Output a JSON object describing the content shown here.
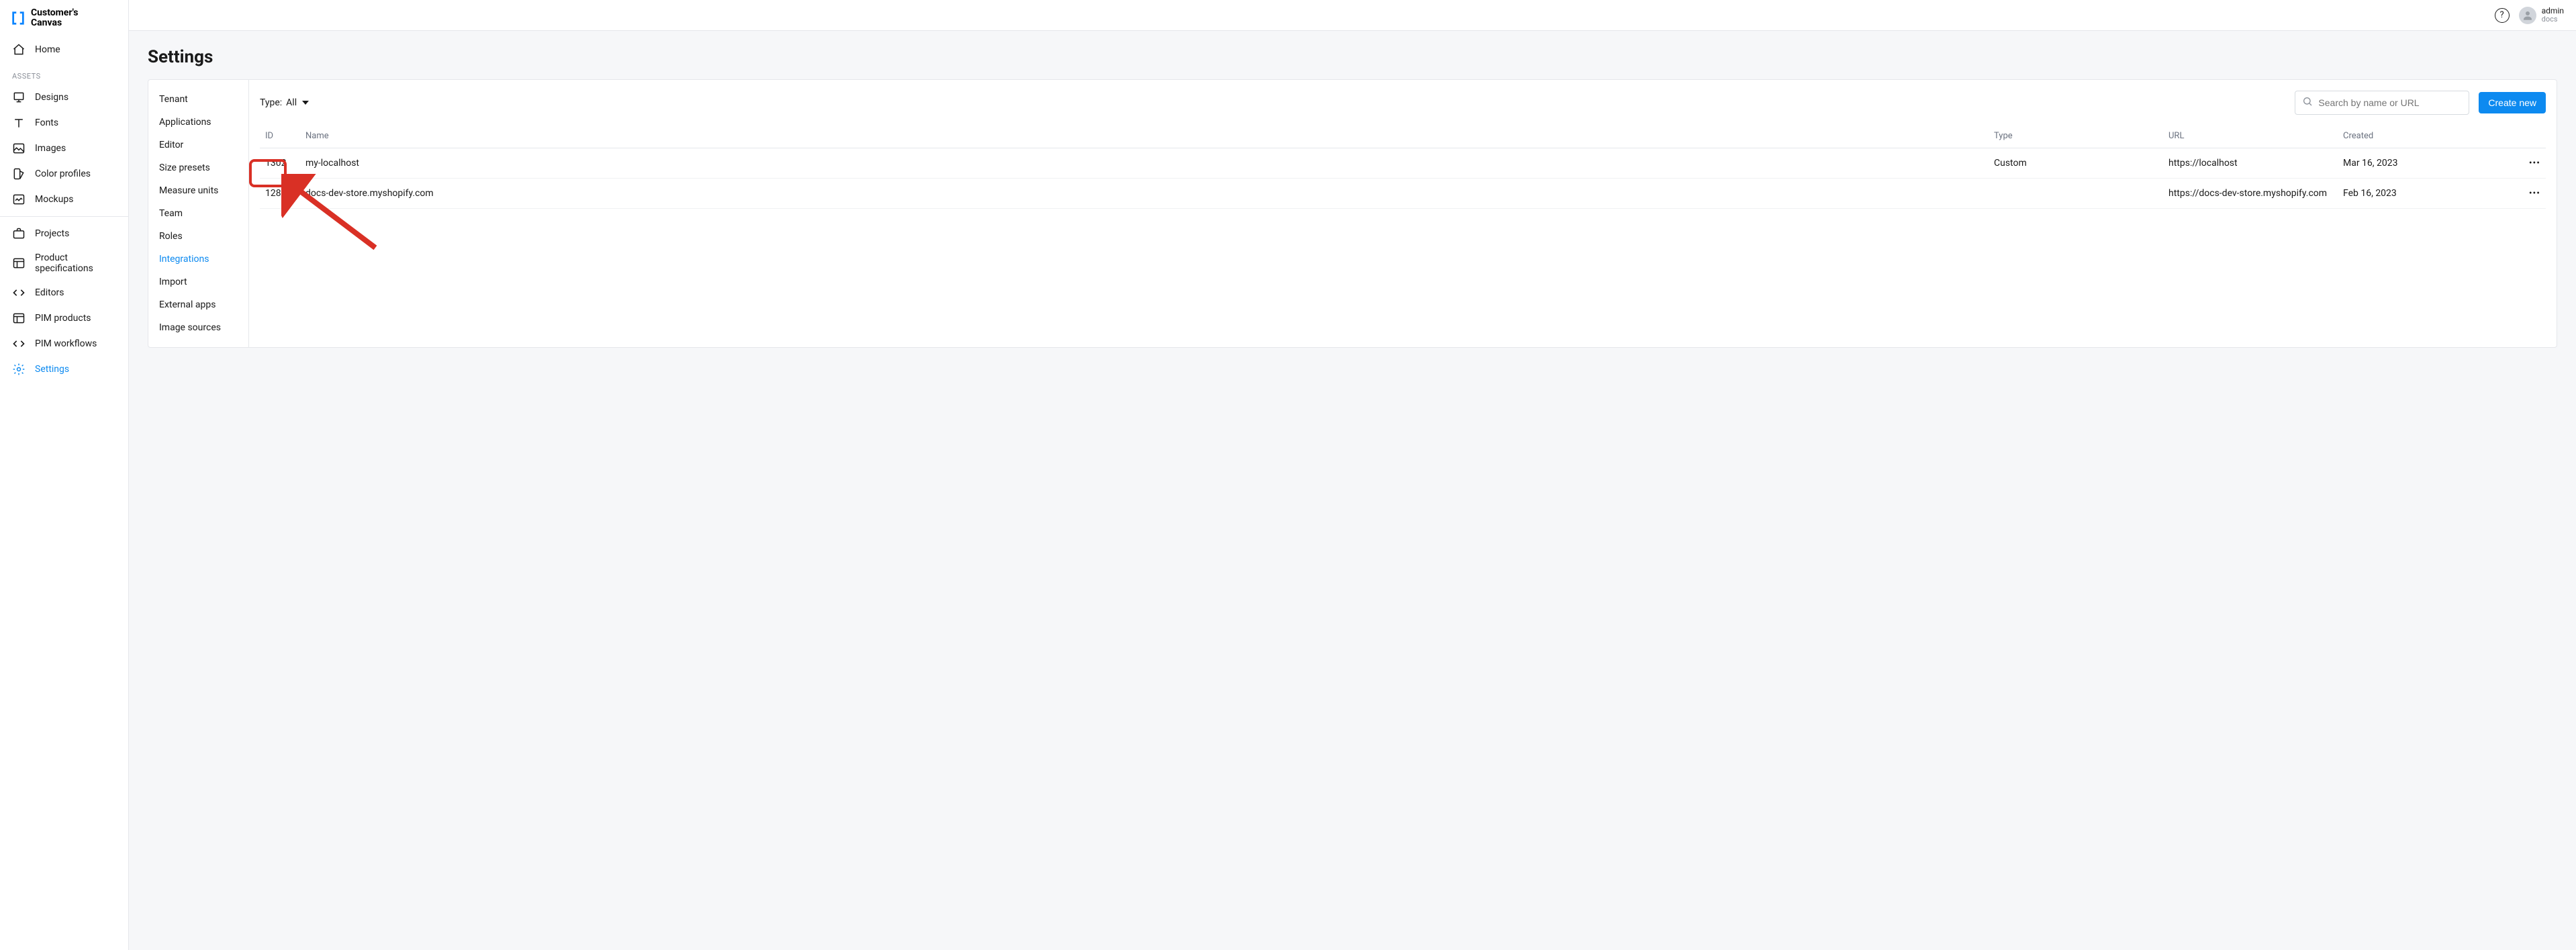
{
  "brand": {
    "name": "Customer's\nCanvas"
  },
  "sidebar": {
    "home": "Home",
    "assets_label": "ASSETS",
    "items_assets": [
      {
        "label": "Designs"
      },
      {
        "label": "Fonts"
      },
      {
        "label": "Images"
      },
      {
        "label": "Color profiles"
      },
      {
        "label": "Mockups"
      }
    ],
    "items_main": [
      {
        "label": "Projects"
      },
      {
        "label": "Product specifications"
      },
      {
        "label": "Editors"
      },
      {
        "label": "PIM products"
      },
      {
        "label": "PIM workflows"
      },
      {
        "label": "Settings"
      }
    ]
  },
  "topbar": {
    "user_name": "admin",
    "user_sub": "docs"
  },
  "page": {
    "title": "Settings"
  },
  "settings_nav": [
    "Tenant",
    "Applications",
    "Editor",
    "Size presets",
    "Measure units",
    "Team",
    "Roles",
    "Integrations",
    "Import",
    "External apps",
    "Image sources"
  ],
  "toolbar": {
    "type_label": "Type:",
    "type_value": "All",
    "search_placeholder": "Search by name or URL",
    "create_label": "Create new"
  },
  "table": {
    "headers": {
      "id": "ID",
      "name": "Name",
      "type": "Type",
      "url": "URL",
      "created": "Created"
    },
    "rows": [
      {
        "id": "1302",
        "name": "my-localhost",
        "type": "Custom",
        "url": "https://localhost",
        "created": "Mar 16, 2023"
      },
      {
        "id": "1288",
        "name": "docs-dev-store.myshopify.com",
        "type": "",
        "url": "https://docs-dev-store.myshopify.com",
        "created": "Feb 16, 2023"
      }
    ]
  }
}
